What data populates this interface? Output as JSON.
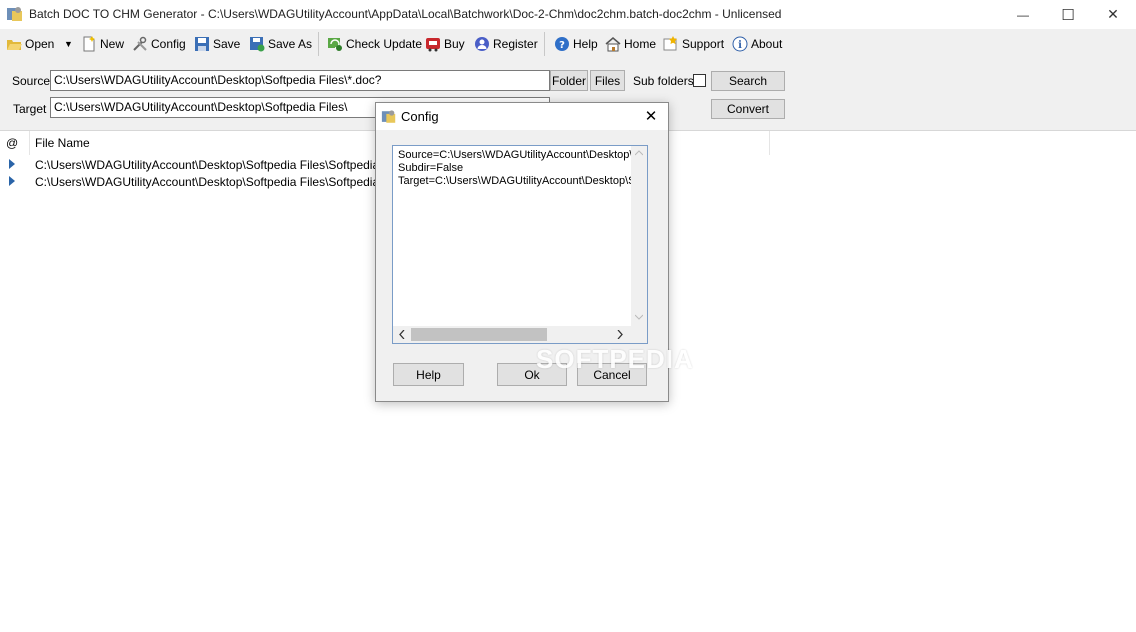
{
  "window": {
    "title": "Batch DOC TO CHM Generator - C:\\Users\\WDAGUtilityAccount\\AppData\\Local\\Batchwork\\Doc-2-Chm\\doc2chm.batch-doc2chm - Unlicensed",
    "minimize": "—",
    "maximize": "☐",
    "close": "✕"
  },
  "toolbar": {
    "open": "Open",
    "dropdown": "▼",
    "new": "New",
    "config": "Config",
    "save": "Save",
    "save_as": "Save As",
    "check_update": "Check Update",
    "buy": "Buy",
    "register": "Register",
    "help": "Help",
    "home": "Home",
    "support": "Support",
    "about": "About"
  },
  "panel": {
    "source_label": "Source",
    "source_value": "C:\\Users\\WDAGUtilityAccount\\Desktop\\Softpedia Files\\*.doc?",
    "target_label": "Target",
    "target_value": "C:\\Users\\WDAGUtilityAccount\\Desktop\\Softpedia Files\\",
    "folder_button": "Folder",
    "files_button": "Files",
    "subfolders_label": "Sub folders",
    "search_button": "Search",
    "convert_button": "Convert"
  },
  "file_list": {
    "columns": [
      "@",
      "File Name"
    ],
    "rows": [
      "C:\\Users\\WDAGUtilityAccount\\Desktop\\Softpedia Files\\Softpedia Test.doc",
      "C:\\Users\\WDAGUtilityAccount\\Desktop\\Softpedia Files\\Softpedia.docx"
    ]
  },
  "dialog": {
    "title": "Config",
    "close": "✕",
    "lines": [
      "Source=C:\\Users\\WDAGUtilityAccount\\Desktop\\Softpedia Files\\*.doc?",
      "Subdir=False",
      "Target=C:\\Users\\WDAGUtilityAccount\\Desktop\\Softpedia Files\\"
    ],
    "help_button": "Help",
    "ok_button": "Ok",
    "cancel_button": "Cancel"
  },
  "watermark": "SOFTPEDIA",
  "colors": {
    "toolbar_bg": "#f0f0f0",
    "accent": "#2a64a8"
  }
}
